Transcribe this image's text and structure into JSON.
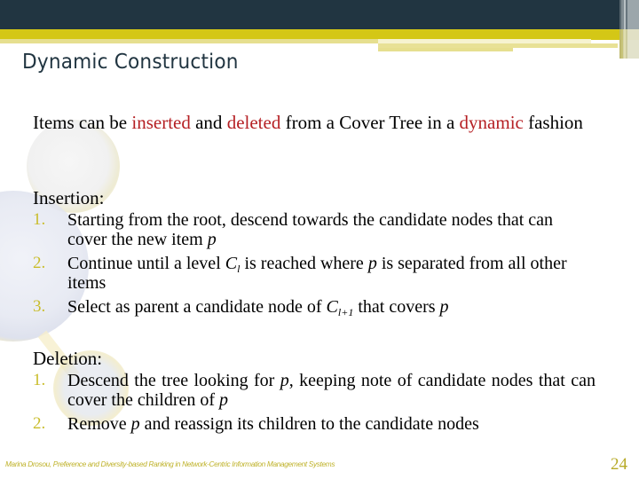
{
  "slide": {
    "title": "Dynamic Construction",
    "intro": {
      "parts": [
        {
          "text": "Items can be ",
          "highlight": false
        },
        {
          "text": "inserted",
          "highlight": true
        },
        {
          "text": " and ",
          "highlight": false
        },
        {
          "text": "deleted",
          "highlight": true
        },
        {
          "text": " from a Cover Tree in a ",
          "highlight": false
        },
        {
          "text": "dynamic",
          "highlight": true
        },
        {
          "text": " fashion",
          "highlight": false
        }
      ]
    },
    "insertion": {
      "heading": "Insertion:",
      "items": [
        {
          "number": "1.",
          "parts": [
            {
              "text": "Starting from the root, descend towards the candidate nodes that can cover the new item "
            },
            {
              "var": "p"
            }
          ]
        },
        {
          "number": "2.",
          "parts": [
            {
              "text": "Continue until a level "
            },
            {
              "var": "C",
              "sub": "l"
            },
            {
              "text": " is reached where "
            },
            {
              "var": "p"
            },
            {
              "text": " is separated from all other items"
            }
          ]
        },
        {
          "number": "3.",
          "parts": [
            {
              "text": "Select as parent a candidate node of "
            },
            {
              "var": "C",
              "sub": "l+1"
            },
            {
              "text": " that covers "
            },
            {
              "var": "p"
            }
          ]
        }
      ]
    },
    "deletion": {
      "heading": "Deletion:",
      "items": [
        {
          "number": "1.",
          "parts": [
            {
              "text": "Descend the tree looking for "
            },
            {
              "var": "p"
            },
            {
              "text": ", keeping note of candidate nodes that can cover the children of "
            },
            {
              "var": "p"
            }
          ]
        },
        {
          "number": "2.",
          "parts": [
            {
              "text": "Remove "
            },
            {
              "var": "p"
            },
            {
              "text": " and reassign its children to the candidate nodes"
            }
          ]
        }
      ]
    },
    "footer": "Marina Drosou, Preference and Diversity-based Ranking in Network-Centric Information Management Systems",
    "page_number": "24"
  },
  "colors": {
    "header_dark": "#213541",
    "header_accent": "#d4c716",
    "highlight_red": "#b51f23",
    "list_number": "#c9bd2b",
    "footer_text": "#bfb22a"
  }
}
